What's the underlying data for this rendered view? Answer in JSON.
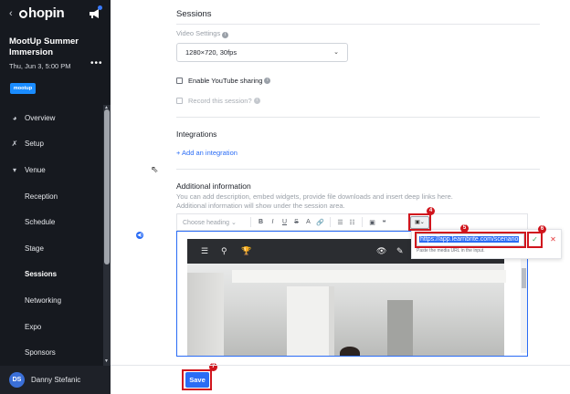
{
  "sidebar": {
    "logo": "hopin",
    "event_title": "MootUp Summer Immersion",
    "event_date": "Thu, Jun 3, 5:00 PM",
    "more": "•••",
    "badge": "mootup",
    "nav": [
      {
        "label": "Overview",
        "icon": "pie-icon"
      },
      {
        "label": "Setup",
        "icon": "wrench-icon"
      },
      {
        "label": "Venue",
        "icon": "caret-down-icon"
      },
      {
        "label": "Reception"
      },
      {
        "label": "Schedule"
      },
      {
        "label": "Stage"
      },
      {
        "label": "Sessions",
        "active": true
      },
      {
        "label": "Networking"
      },
      {
        "label": "Expo"
      },
      {
        "label": "Sponsors"
      }
    ],
    "user": {
      "initials": "DS",
      "name": "Danny Stefanic"
    }
  },
  "main": {
    "section_title": "Sessions",
    "video_settings_label": "Video Settings",
    "video_settings_value": "1280×720, 30fps",
    "youtube_label": "Enable YouTube sharing",
    "record_label": "Record this session?",
    "integrations_title": "Integrations",
    "add_integration": "+ Add an integration",
    "additional_title": "Additional information",
    "additional_desc": "You can add description, embed widgets, provide file downloads and insert deep links here. Additional information will show under the session area.",
    "toolbar": {
      "heading_select": "Choose heading",
      "buttons": [
        "B",
        "I",
        "U",
        "S",
        "A",
        "🔗",
        "☰",
        "☷",
        "▣",
        "❝"
      ]
    },
    "editor_marker": "◀)",
    "popover": {
      "url_value": "https://app.learnbrite.com/scenario",
      "hint": "Paste the media URL in the input.",
      "confirm": "✓",
      "cancel": "✕"
    },
    "save_label": "Save",
    "annotations": [
      "4",
      "5",
      "6",
      "7"
    ]
  },
  "colors": {
    "sidebar_bg": "#16191f",
    "accent": "#2a6cf5",
    "annotation_red": "#d0151d"
  }
}
